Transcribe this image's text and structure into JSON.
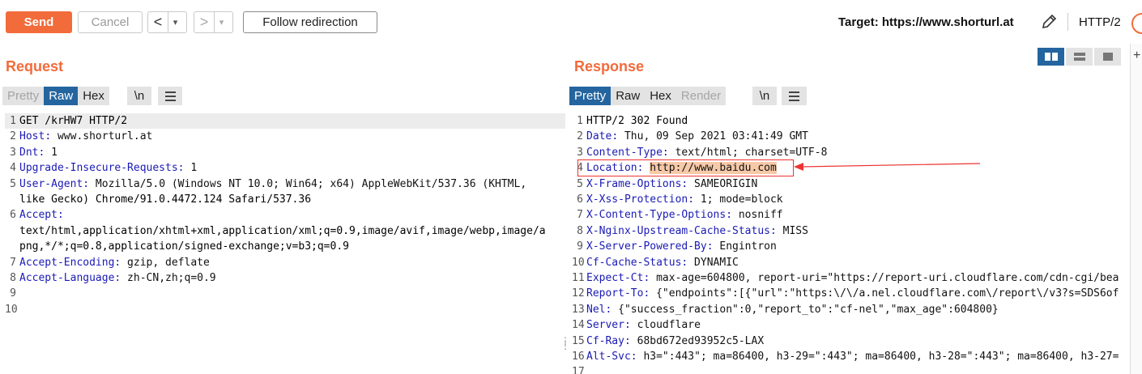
{
  "toolbar": {
    "send_label": "Send",
    "cancel_label": "Cancel",
    "back_arrow": "<",
    "forward_arrow": ">",
    "dropdown_glyph": "▾",
    "follow_label": "Follow redirection",
    "target_label": "Target: https://www.shorturl.at",
    "protocol_label": "HTTP/2"
  },
  "request": {
    "title": "Request",
    "tabs": [
      "Pretty",
      "Raw",
      "Hex"
    ],
    "active_tab": "Raw",
    "newline_label": "\\n",
    "lines": [
      {
        "num": "1",
        "text": "GET /krHW7 HTTP/2"
      },
      {
        "num": "2",
        "header": "Host",
        "value": " www.shorturl.at"
      },
      {
        "num": "3",
        "header": "Dnt",
        "value": " 1"
      },
      {
        "num": "4",
        "header": "Upgrade-Insecure-Requests",
        "value": " 1"
      },
      {
        "num": "5",
        "header": "User-Agent",
        "value": " Mozilla/5.0 (Windows NT 10.0; Win64; x64) AppleWebKit/537.36 (KHTML,"
      },
      {
        "num": "",
        "text": "like Gecko) Chrome/91.0.4472.124 Safari/537.36"
      },
      {
        "num": "6",
        "header": "Accept",
        "value": ""
      },
      {
        "num": "",
        "text": "text/html,application/xhtml+xml,application/xml;q=0.9,image/avif,image/webp,image/a"
      },
      {
        "num": "",
        "text": "png,*/*;q=0.8,application/signed-exchange;v=b3;q=0.9"
      },
      {
        "num": "7",
        "header": "Accept-Encoding",
        "value": " gzip, deflate"
      },
      {
        "num": "8",
        "header": "Accept-Language",
        "value": " zh-CN,zh;q=0.9"
      },
      {
        "num": "9",
        "text": ""
      },
      {
        "num": "10",
        "text": ""
      }
    ]
  },
  "response": {
    "title": "Response",
    "tabs": [
      "Pretty",
      "Raw",
      "Hex",
      "Render"
    ],
    "active_tab": "Pretty",
    "newline_label": "\\n",
    "lines": [
      {
        "num": "1",
        "text": "HTTP/2 302 Found"
      },
      {
        "num": "2",
        "header": "Date",
        "value": " Thu, 09 Sep 2021 03:41:49 GMT"
      },
      {
        "num": "3",
        "header": "Content-Type",
        "value": " text/html; charset=UTF-8"
      },
      {
        "num": "4",
        "header": "Location",
        "value": " http://www.baidu.com",
        "highlight": true
      },
      {
        "num": "5",
        "header": "X-Frame-Options",
        "value": " SAMEORIGIN"
      },
      {
        "num": "6",
        "header": "X-Xss-Protection",
        "value": " 1; mode=block"
      },
      {
        "num": "7",
        "header": "X-Content-Type-Options",
        "value": " nosniff"
      },
      {
        "num": "8",
        "header": "X-Nginx-Upstream-Cache-Status",
        "value": " MISS"
      },
      {
        "num": "9",
        "header": "X-Server-Powered-By",
        "value": " Engintron"
      },
      {
        "num": "10",
        "header": "Cf-Cache-Status",
        "value": " DYNAMIC"
      },
      {
        "num": "11",
        "header": "Expect-Ct",
        "value": " max-age=604800, report-uri=\"https://report-uri.cloudflare.com/cdn-cgi/bea"
      },
      {
        "num": "12",
        "header": "Report-To",
        "value": " {\"endpoints\":[{\"url\":\"https:\\/\\/a.nel.cloudflare.com\\/report\\/v3?s=SDS6of"
      },
      {
        "num": "13",
        "header": "Nel",
        "value": " {\"success_fraction\":0,\"report_to\":\"cf-nel\",\"max_age\":604800}"
      },
      {
        "num": "14",
        "header": "Server",
        "value": " cloudflare"
      },
      {
        "num": "15",
        "header": "Cf-Ray",
        "value": " 68bd672ed93952c5-LAX"
      },
      {
        "num": "16",
        "header": "Alt-Svc",
        "value": " h3=\":443\"; ma=86400, h3-29=\":443\"; ma=86400, h3-28=\":443\"; ma=86400, h3-27="
      },
      {
        "num": "17",
        "text": ""
      }
    ]
  },
  "colors": {
    "accent": "#f26b3a",
    "active_tab": "#24659f",
    "header_name": "#1a1ab5",
    "annotation": "#e33333"
  },
  "icons": {
    "pencil": "pencil-icon",
    "help": "help-icon",
    "menu": "menu-icon"
  }
}
